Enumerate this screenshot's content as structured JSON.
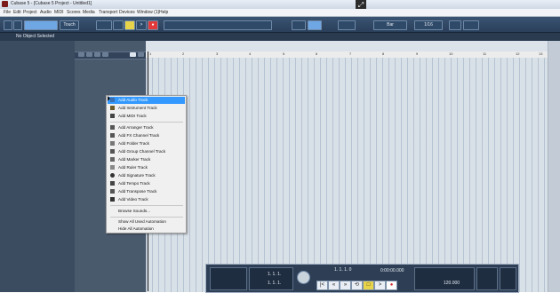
{
  "window": {
    "title": "Cubase 5 - [Cubase 5 Project - Untitled1]"
  },
  "menu": {
    "items": [
      "File",
      "Edit",
      "Project",
      "Audio",
      "MIDI",
      "Scores",
      "Media",
      "Transport",
      "Devices",
      "Window (1)",
      "Help"
    ]
  },
  "toolbar": {
    "touch_label": "Touch",
    "bar_label": "Bar",
    "zoom_label": "1/16"
  },
  "status": {
    "no_object": "No Object Selected"
  },
  "ruler": {
    "numbers": [
      "1",
      "2",
      "3",
      "4",
      "5",
      "6",
      "7",
      "8",
      "9",
      "10",
      "11",
      "12",
      "13"
    ]
  },
  "context_menu": {
    "items": [
      {
        "label": "Add Audio Track",
        "icon": "audio-track-icon",
        "highlighted": true
      },
      {
        "label": "Add Instrument Track",
        "icon": "instrument-track-icon"
      },
      {
        "label": "Add MIDI Track",
        "icon": "midi-track-icon"
      },
      {
        "label": "Add Arranger Track",
        "icon": "arranger-track-icon"
      },
      {
        "label": "Add FX Channel Track",
        "icon": "fx-channel-icon"
      },
      {
        "label": "Add Folder Track",
        "icon": "folder-track-icon"
      },
      {
        "label": "Add Group Channel Track",
        "icon": "group-channel-icon"
      },
      {
        "label": "Add Marker Track",
        "icon": "marker-track-icon"
      },
      {
        "label": "Add Ruler Track",
        "icon": "ruler-track-icon"
      },
      {
        "label": "Add Signature Track",
        "icon": "signature-track-icon"
      },
      {
        "label": "Add Tempo Track",
        "icon": "tempo-track-icon"
      },
      {
        "label": "Add Transpose Track",
        "icon": "transpose-track-icon"
      },
      {
        "label": "Add Video Track",
        "icon": "video-track-icon"
      },
      {
        "label": "Browse Sounds...",
        "icon": ""
      },
      {
        "label": "Show All Used Automation",
        "icon": ""
      },
      {
        "label": "Hide All Automation",
        "icon": ""
      }
    ]
  },
  "transport": {
    "position_left": "1. 1. 1.",
    "position_right": "1. 1. 1.",
    "main_position": "1. 1. 1. 0",
    "time_display": "0:00:00.000",
    "tempo": "120.000"
  },
  "colors": {
    "toolbar": "#2a3f5a",
    "highlight": "#3399ff",
    "project_bg": "#d8e0e8",
    "play": "#e8d44a",
    "record": "#d62828"
  }
}
